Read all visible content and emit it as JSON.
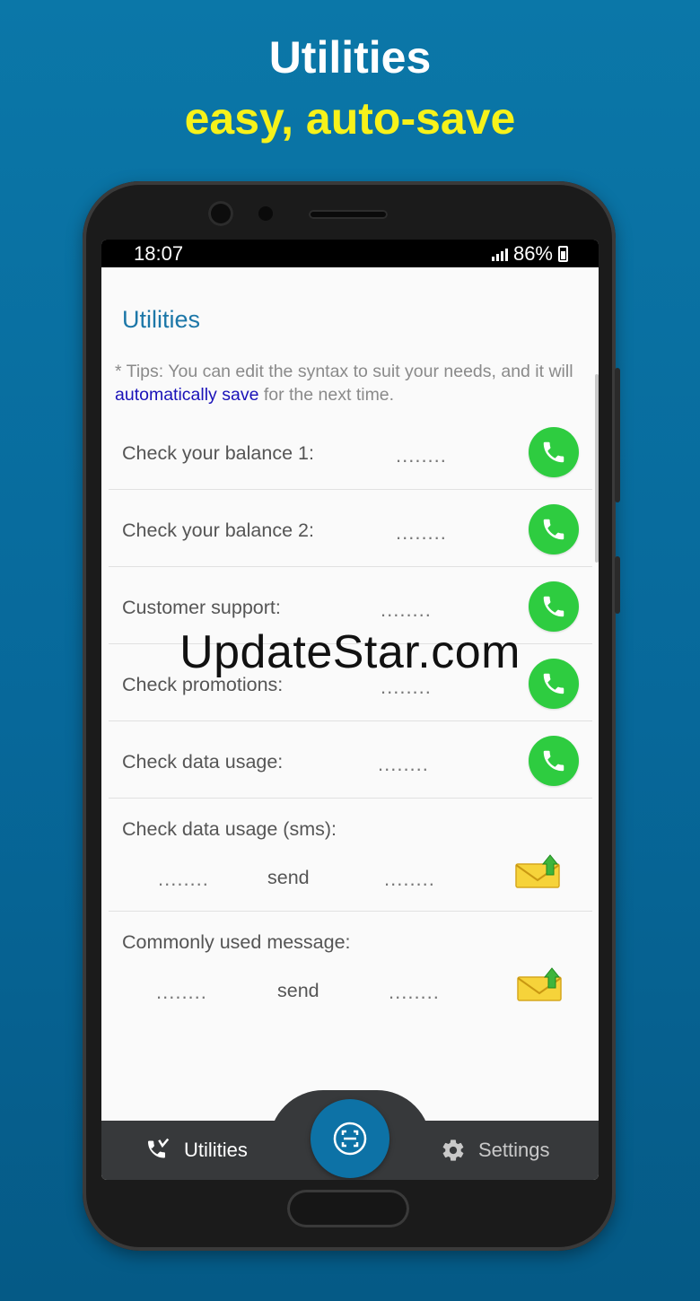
{
  "promo": {
    "title": "Utilities",
    "subtitle": "easy, auto-save",
    "title_color": "#ffffff",
    "subtitle_color": "#f7f21a",
    "background": "#0b77a8"
  },
  "status_bar": {
    "time": "18:07",
    "battery": "86%",
    "icons": [
      "signal-icon",
      "battery-charging-icon"
    ]
  },
  "page": {
    "heading": "Utilities",
    "tips_prefix": "* Tips: You can edit the syntax to suit your needs, and it will ",
    "tips_highlight": "automatically save",
    "tips_suffix": " for the next time."
  },
  "call_rows": [
    {
      "label": "Check your balance 1:",
      "code": "........",
      "icon": "phone-call-icon"
    },
    {
      "label": "Check your balance 2:",
      "code": "........",
      "icon": "phone-call-icon"
    },
    {
      "label": "Customer support:",
      "code": "........",
      "icon": "phone-call-icon"
    },
    {
      "label": "Check promotions:",
      "code": "........",
      "icon": "phone-call-icon"
    },
    {
      "label": "Check data usage:",
      "code": "........",
      "icon": "phone-call-icon"
    }
  ],
  "sms_rows": [
    {
      "label": "Check data usage (sms):",
      "content": "........",
      "send": "send",
      "number": "........",
      "icon": "send-mail-icon"
    },
    {
      "label": "Commonly used message:",
      "content": "........",
      "send": "send",
      "number": "........",
      "icon": "send-mail-icon"
    }
  ],
  "bottom_nav": {
    "utilities": "Utilities",
    "settings": "Settings",
    "fab_icon": "scan-icon"
  },
  "colors": {
    "accent": "#1c77a8",
    "call_green": "#2ecc40",
    "nav_bg": "#37393b",
    "fab": "#0d72a6"
  },
  "watermark": "UpdateStar.com"
}
